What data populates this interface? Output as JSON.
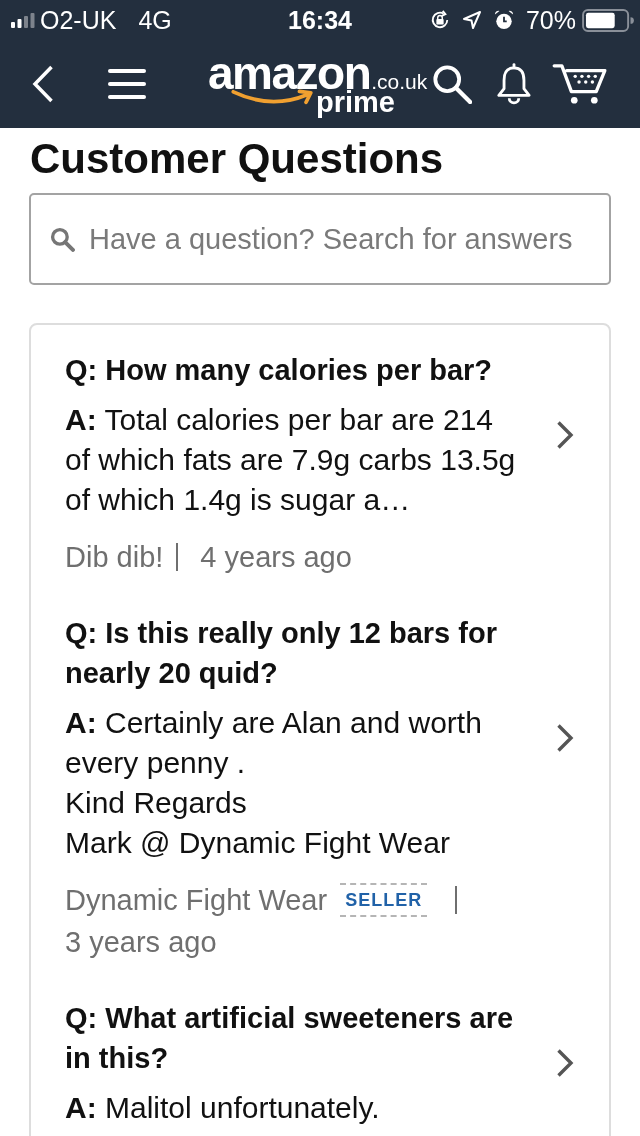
{
  "status_bar": {
    "carrier": "O2-UK",
    "network": "4G",
    "time": "16:34",
    "battery": "70%"
  },
  "nav_bar": {
    "logo": {
      "wordmark": "amazon",
      "domain": ".co.uk",
      "subtitle": "prime"
    }
  },
  "page_title": "Customer Questions",
  "search": {
    "placeholder": "Have a question? Search for answers"
  },
  "questions": [
    {
      "question": "Q: How many calories per bar?",
      "answer": "**A:** Total calories per bar are 214\nof which fats are 7.9g carbs 13.5g\nof which 1.4g is sugar a…",
      "author": "Dib dib!",
      "date": "4 years ago"
    },
    {
      "question": "Q: Is this really only 12 bars for nearly 20 quid?",
      "answer": "**A:** Certainly are Alan and worth every penny .\nKind Regards\nMark @ Dynamic Fight Wear",
      "author": "Dynamic Fight Wear",
      "badge": "SELLER",
      "date": "3 years ago"
    },
    {
      "question": "Q: What artificial sweeteners are in this?",
      "answer": "**A:** Malitol unfortunately."
    }
  ]
}
